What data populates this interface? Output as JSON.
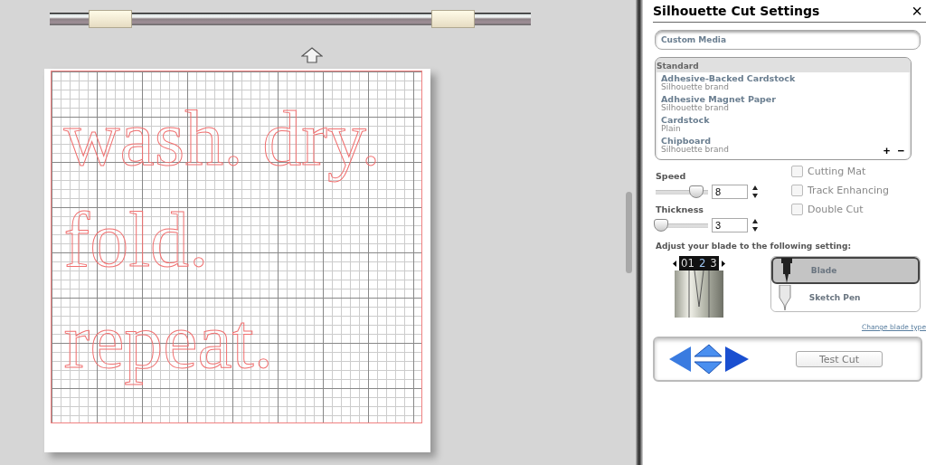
{
  "canvas": {
    "design_lines": [
      "wash. dry.",
      "fold.",
      "repeat."
    ]
  },
  "panel": {
    "title": "Silhouette Cut Settings",
    "close": "×",
    "media_tab": "Custom Media",
    "media_list": {
      "group": "Standard",
      "items": [
        {
          "name": "Adhesive-Backed Cardstock",
          "detail": "Silhouette brand",
          "selected": false
        },
        {
          "name": "Adhesive Magnet Paper",
          "detail": "Silhouette brand",
          "selected": false
        },
        {
          "name": "Cardstock",
          "detail": "Plain",
          "selected": false
        },
        {
          "name": "Chipboard",
          "detail": "Silhouette brand",
          "selected": false
        }
      ],
      "add": "+",
      "remove": "−"
    },
    "sliders": [
      {
        "label": "Speed",
        "value": "8",
        "level": 0.78
      },
      {
        "label": "Thickness",
        "value": "3",
        "level": 0.1
      }
    ],
    "options": [
      {
        "label": "Cutting Mat",
        "checked": false
      },
      {
        "label": "Track Enhancing",
        "checked": false
      },
      {
        "label": "Double Cut",
        "checked": false
      }
    ],
    "blade_prompt": "Adjust your blade to the following setting:",
    "dial_numbers": [
      {
        "text": "01",
        "selected": false
      },
      {
        "text": "2",
        "selected": true
      },
      {
        "text": "3",
        "selected": false
      }
    ],
    "tools": [
      {
        "label": "Blade",
        "kind": "blade",
        "selected": true
      },
      {
        "label": "Sketch Pen",
        "kind": "pen",
        "selected": false
      }
    ],
    "change_link": "Change blade type",
    "test_cut": "Test Cut"
  }
}
